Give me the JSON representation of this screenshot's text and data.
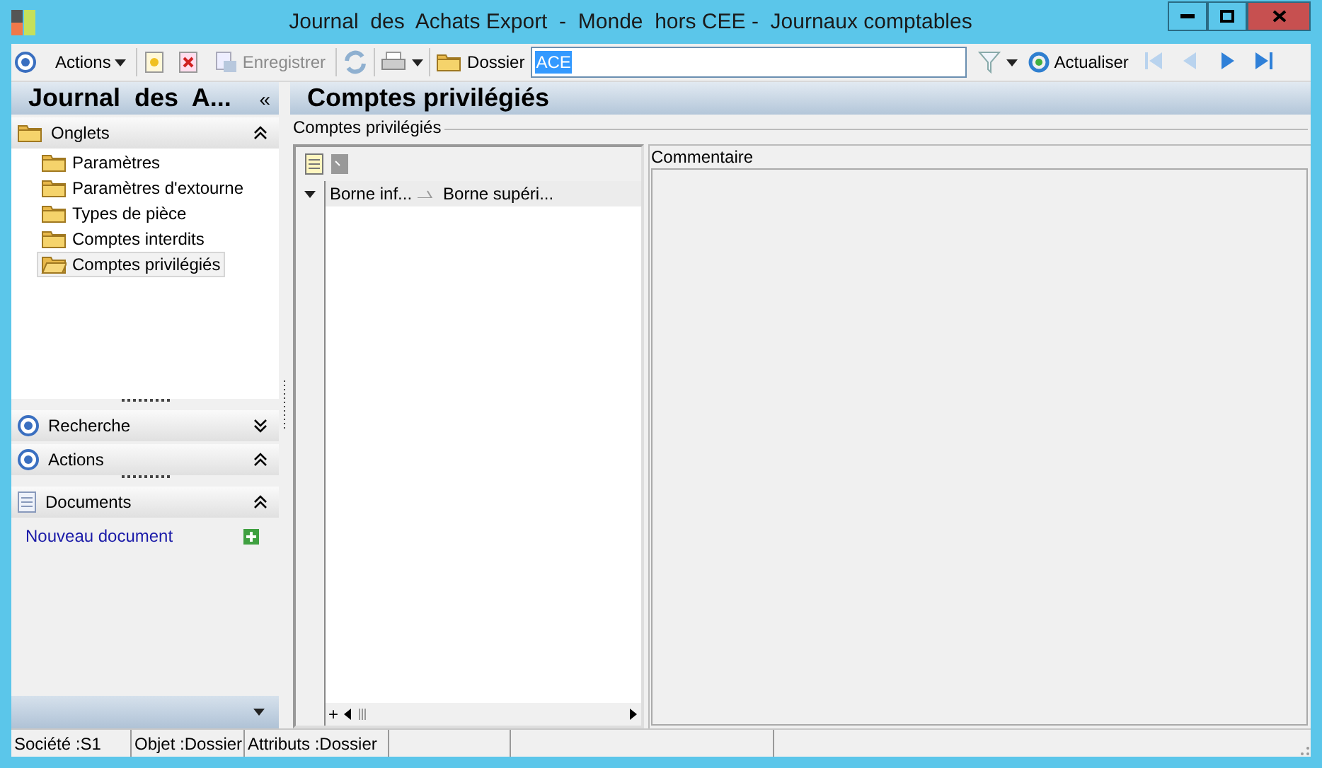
{
  "window": {
    "title": "Journal  des  Achats Export  -  Monde  hors CEE -  Journaux comptables"
  },
  "toolbar": {
    "actions": "Actions",
    "save": {
      "label": "Enregistrer",
      "disabled": true
    },
    "dossier_label": "Dossier",
    "dossier_value": "ACE",
    "refresh": "Actualiser",
    "nav": [
      {
        "kind": "first",
        "disabled": true
      },
      {
        "kind": "prev",
        "disabled": true
      },
      {
        "kind": "next",
        "disabled": false
      },
      {
        "kind": "last",
        "disabled": false
      }
    ]
  },
  "sidebar": {
    "title": "Journal  des  A...",
    "collapse": "«",
    "onglets": {
      "title": "Onglets",
      "expanded": true,
      "items": [
        {
          "label": "Paramètres",
          "selected": false
        },
        {
          "label": "Paramètres d'extourne",
          "selected": false
        },
        {
          "label": "Types de pièce",
          "selected": false
        },
        {
          "label": "Comptes interdits",
          "selected": false
        },
        {
          "label": "Comptes privilégiés",
          "selected": true
        }
      ]
    },
    "recherche": {
      "title": "Recherche",
      "expanded": false
    },
    "actions": {
      "title": "Actions",
      "expanded": true
    },
    "documents": {
      "title": "Documents",
      "expanded": true,
      "link": "Nouveau document"
    }
  },
  "main": {
    "title": "Comptes privilégiés",
    "group_label": "Comptes privilégiés",
    "columns": [
      "Borne inf...",
      "Borne supéri..."
    ],
    "comment_label": "Commentaire",
    "add": "+"
  },
  "status_bar": [
    "Société :S1",
    "Objet :Dossier",
    "Attributs :Dossier"
  ]
}
